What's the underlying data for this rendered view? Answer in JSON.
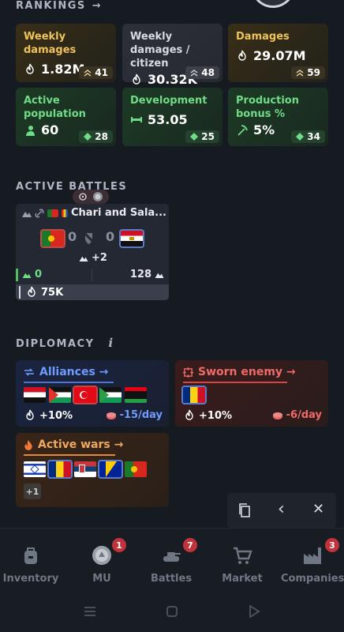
{
  "rankings": {
    "title": "RANKINGS",
    "arrow": "→",
    "cards": [
      {
        "label": "Weekly damages",
        "value": "1.82M",
        "rank": "41",
        "theme": "orange"
      },
      {
        "label": "Weekly damages / citizen",
        "value": "30.32K",
        "rank": "48",
        "theme": "gray"
      },
      {
        "label": "Damages",
        "value": "29.07M",
        "rank": "59",
        "theme": "orange"
      },
      {
        "label": "Active population",
        "value": "60",
        "rank": "28",
        "theme": "green"
      },
      {
        "label": "Development",
        "value": "53.05",
        "rank": "25",
        "theme": "green"
      },
      {
        "label": "Production bonus %",
        "value": "5%",
        "rank": "34",
        "theme": "green"
      }
    ]
  },
  "active_battles": {
    "title": "ACTIVE BATTLES",
    "battle": {
      "name": "Chari and Sala...",
      "left_score": "0",
      "right_score": "0",
      "extra": "+2",
      "left_count": "0",
      "right_count": "128",
      "damage": "75K"
    }
  },
  "diplomacy": {
    "title": "DIPLOMACY",
    "info": "i",
    "alliances": {
      "title": "Alliances →",
      "bonus": "+10%",
      "cost": "-15/day"
    },
    "sworn_enemy": {
      "title": "Sworn enemy →",
      "bonus": "+10%",
      "cost": "-6/day"
    },
    "active_wars": {
      "title": "Active wars →",
      "more": "+1"
    }
  },
  "overlay": {
    "copy": "copy-icon",
    "back": "‹",
    "close": "✕"
  },
  "bottom_nav": {
    "items": [
      {
        "label": "Inventory",
        "badge": ""
      },
      {
        "label": "MU",
        "badge": "1"
      },
      {
        "label": "Battles",
        "badge": "7"
      },
      {
        "label": "Market",
        "badge": ""
      },
      {
        "label": "Companies",
        "badge": "3"
      }
    ]
  },
  "colors": {
    "orange": "#f0c35a",
    "green": "#6fdc86",
    "blue": "#5b8cff",
    "red": "#e05a5a",
    "badge": "#c0333a"
  }
}
